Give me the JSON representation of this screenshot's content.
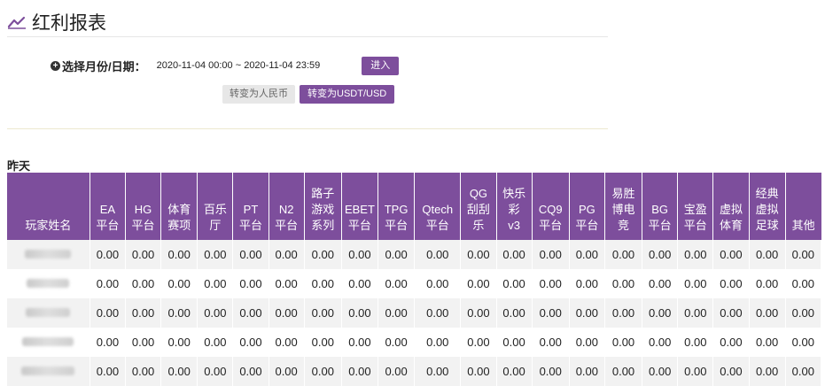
{
  "page": {
    "title": "红利报表",
    "accent_color": "#7d4e9c"
  },
  "filter": {
    "label": "选择月份/日期：",
    "date_range": "2020-11-04 00:00 ~ 2020-11-04 23:59",
    "enter_label": "进入"
  },
  "currency": {
    "rmb_label": "转变为人民币",
    "usd_label": "转变为USDT/USD",
    "active": "usd"
  },
  "section": {
    "label": "昨天"
  },
  "table": {
    "headers": [
      "玩家姓名",
      "EA\n平台",
      "HG\n平台",
      "体育\n赛项",
      "百乐\n厅",
      "PT\n平台",
      "N2\n平台",
      "路子\n游戏\n系列",
      "EBET\n平台",
      "TPG\n平台",
      "Qtech\n平台",
      "QG\n刮刮\n乐",
      "快乐\n彩\nv3",
      "CQ9\n平台",
      "PG\n平台",
      "易胜\n博电\n竞",
      "BG\n平台",
      "宝盈\n平台",
      "虚拟\n体育",
      "经典\n虚拟\n足球",
      "其他"
    ],
    "rows": [
      {
        "name": "",
        "values": [
          "0.00",
          "0.00",
          "0.00",
          "0.00",
          "0.00",
          "0.00",
          "0.00",
          "0.00",
          "0.00",
          "0.00",
          "0.00",
          "0.00",
          "0.00",
          "0.00",
          "0.00",
          "0.00",
          "0.00",
          "0.00",
          "0.00",
          "0.00"
        ]
      },
      {
        "name": "",
        "values": [
          "0.00",
          "0.00",
          "0.00",
          "0.00",
          "0.00",
          "0.00",
          "0.00",
          "0.00",
          "0.00",
          "0.00",
          "0.00",
          "0.00",
          "0.00",
          "0.00",
          "0.00",
          "0.00",
          "0.00",
          "0.00",
          "0.00",
          "0.00"
        ]
      },
      {
        "name": "",
        "values": [
          "0.00",
          "0.00",
          "0.00",
          "0.00",
          "0.00",
          "0.00",
          "0.00",
          "0.00",
          "0.00",
          "0.00",
          "0.00",
          "0.00",
          "0.00",
          "0.00",
          "0.00",
          "0.00",
          "0.00",
          "0.00",
          "0.00",
          "0.00"
        ]
      },
      {
        "name": "",
        "values": [
          "0.00",
          "0.00",
          "0.00",
          "0.00",
          "0.00",
          "0.00",
          "0.00",
          "0.00",
          "0.00",
          "0.00",
          "0.00",
          "0.00",
          "0.00",
          "0.00",
          "0.00",
          "0.00",
          "0.00",
          "0.00",
          "0.00",
          "0.00"
        ]
      },
      {
        "name": "",
        "values": [
          "0.00",
          "0.00",
          "0.00",
          "0.00",
          "0.00",
          "0.00",
          "0.00",
          "0.00",
          "0.00",
          "0.00",
          "0.00",
          "0.00",
          "0.00",
          "0.00",
          "0.00",
          "0.00",
          "0.00",
          "0.00",
          "0.00",
          "0.00"
        ]
      }
    ]
  }
}
